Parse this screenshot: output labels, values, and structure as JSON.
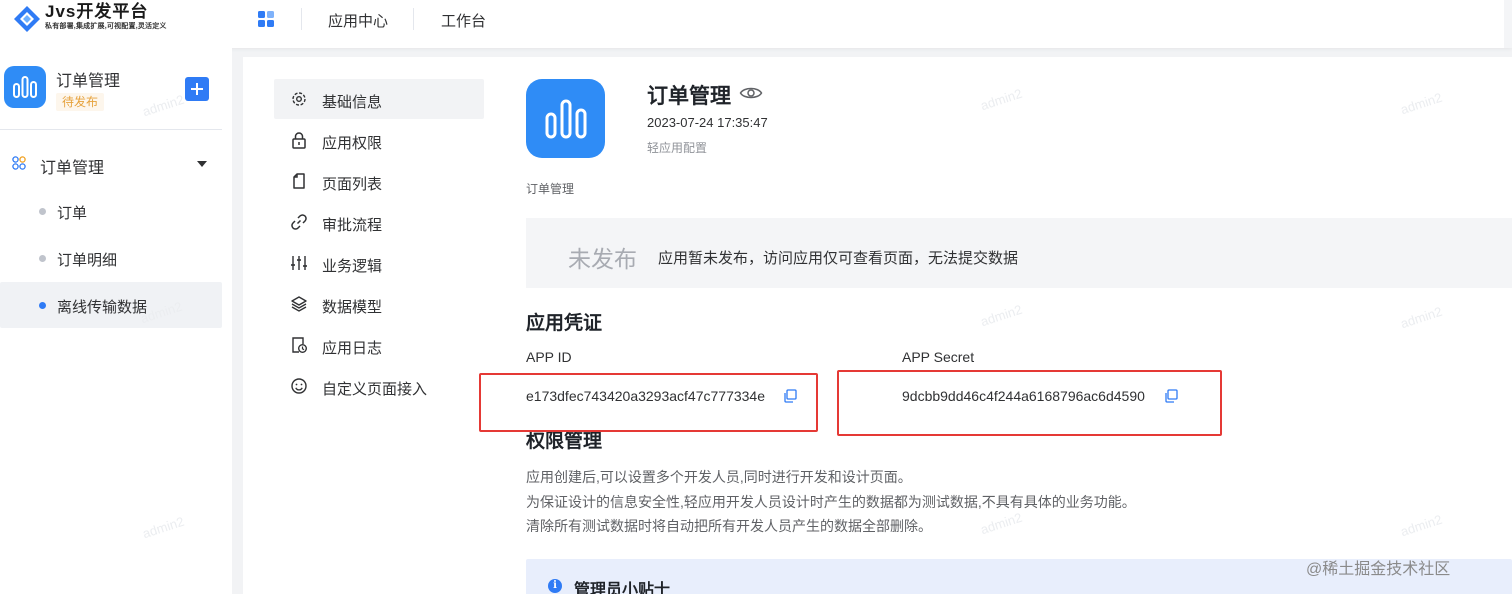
{
  "header": {
    "logo_title": "Jvs开发平台",
    "logo_subtitle": "私有部署,集成扩展,可视配置,灵活定义",
    "nav": [
      "应用中心",
      "工作台"
    ]
  },
  "app": {
    "name": "订单管理",
    "status": "待发布",
    "group": "订单管理",
    "pages": [
      "订单",
      "订单明细",
      "离线传输数据"
    ]
  },
  "menu": [
    "基础信息",
    "应用权限",
    "页面列表",
    "审批流程",
    "业务逻辑",
    "数据模型",
    "应用日志",
    "自定义页面接入"
  ],
  "main": {
    "title": "订单管理",
    "timestamp": "2023-07-24 17:35:47",
    "config_label": "轻应用配置",
    "description": "订单管理",
    "unpublished_status": "未发布",
    "unpublished_text": "应用暂未发布，访问应用仅可查看页面，无法提交数据",
    "credentials": {
      "title": "应用凭证",
      "app_id_label": "APP ID",
      "app_id": "e173dfec743420a3293acf47c777334e",
      "app_secret_label": "APP Secret",
      "app_secret": "9dcbb9dd46c4f244a6168796ac6d4590"
    },
    "permissions": {
      "title": "权限管理",
      "lines": [
        "应用创建后,可以设置多个开发人员,同时进行开发和设计页面。",
        "为保证设计的信息安全性,轻应用开发人员设计时产生的数据都为测试数据,不具有具体的业务功能。",
        "清除所有测试数据时将自动把所有开发人员产生的数据全部删除。"
      ]
    },
    "tip": {
      "title": "管理员小贴士"
    }
  },
  "watermark": "@稀土掘金技术社区",
  "faint_watermark": "admin2",
  "colors": {
    "primary": "#2f7bf5",
    "app_icon_bg": "#2f8cf6",
    "status_tag": "#e6a23c",
    "highlight_box": "#e53935"
  },
  "icons": {
    "menu": [
      "gear-icon",
      "lock-icon",
      "page-icon",
      "link-icon",
      "sliders-icon",
      "layers-icon",
      "log-icon",
      "smiley-icon"
    ]
  }
}
